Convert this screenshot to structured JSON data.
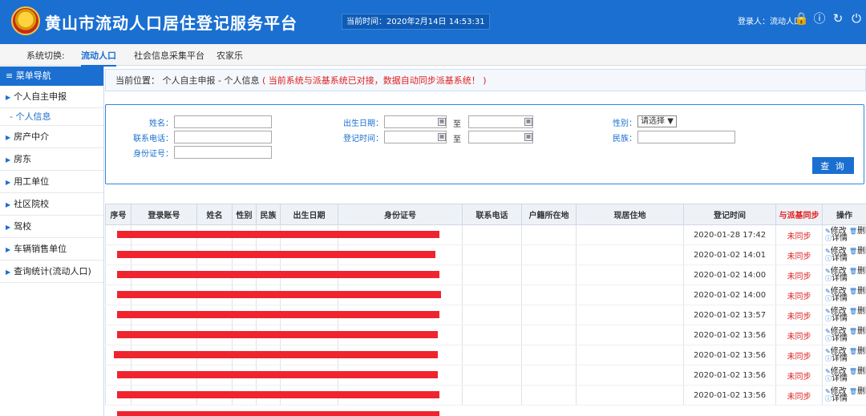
{
  "header": {
    "title": "黄山市流动人口居住登记服务平台",
    "clock_label": "当前时间：2020年2月14日 14:53:31",
    "user_label": "登录人：流动人口",
    "icons": [
      "lock-icon",
      "help-icon",
      "refresh-icon",
      "power-icon"
    ]
  },
  "sysbar": {
    "label": "系统切换:",
    "items": [
      "流动人口",
      "社会信息采集平台",
      "农家乐"
    ],
    "active": "流动人口"
  },
  "sidebar": {
    "header": "菜单导航",
    "items": [
      {
        "label": "个人自主申报"
      },
      {
        "label": "个人信息",
        "sub": true
      },
      {
        "label": "房产中介"
      },
      {
        "label": "房东"
      },
      {
        "label": "用工单位"
      },
      {
        "label": "社区院校"
      },
      {
        "label": "驾校"
      },
      {
        "label": "车辆销售单位"
      },
      {
        "label": "查询统计(流动人口)"
      }
    ]
  },
  "breadcrumb": {
    "prefix": "当前位置：",
    "path": "个人自主申报 - 个人信息",
    "note": "( 当前系统与派基系统已对接，数据自动同步派基系统！ )"
  },
  "search": {
    "name_label": "姓名：",
    "phone_label": "联系电话：",
    "id_label": "身份证号：",
    "birth_label": "出生日期：",
    "reg_label": "登记时间：",
    "to_label": "至",
    "gender_label": "性别：",
    "gender_value": "请选择",
    "ethnic_label": "民族：",
    "query_button": "查 询"
  },
  "table": {
    "headers": [
      "序号",
      "登录账号",
      "姓名",
      "性别",
      "民族",
      "出生日期",
      "身份证号",
      "联系电话",
      "户籍所在地",
      "现居住地",
      "登记时间",
      "与派基同步",
      "操作"
    ],
    "rows": [
      {
        "time": "2020-01-28 17:42",
        "sync": "未同步"
      },
      {
        "time": "2020-01-02 14:01",
        "sync": "未同步"
      },
      {
        "time": "2020-01-02 14:00",
        "sync": "未同步"
      },
      {
        "time": "2020-01-02 14:00",
        "sync": "未同步"
      },
      {
        "time": "2020-01-02 13:57",
        "sync": "未同步"
      },
      {
        "time": "2020-01-02 13:56",
        "sync": "未同步"
      },
      {
        "time": "2020-01-02 13:56",
        "sync": "未同步"
      },
      {
        "time": "2020-01-02 13:56",
        "sync": "未同步"
      },
      {
        "time": "2020-01-02 13:56",
        "sync": "未同步"
      }
    ],
    "op_edit": "修改",
    "op_delete": "删除",
    "op_detail": "详情"
  }
}
